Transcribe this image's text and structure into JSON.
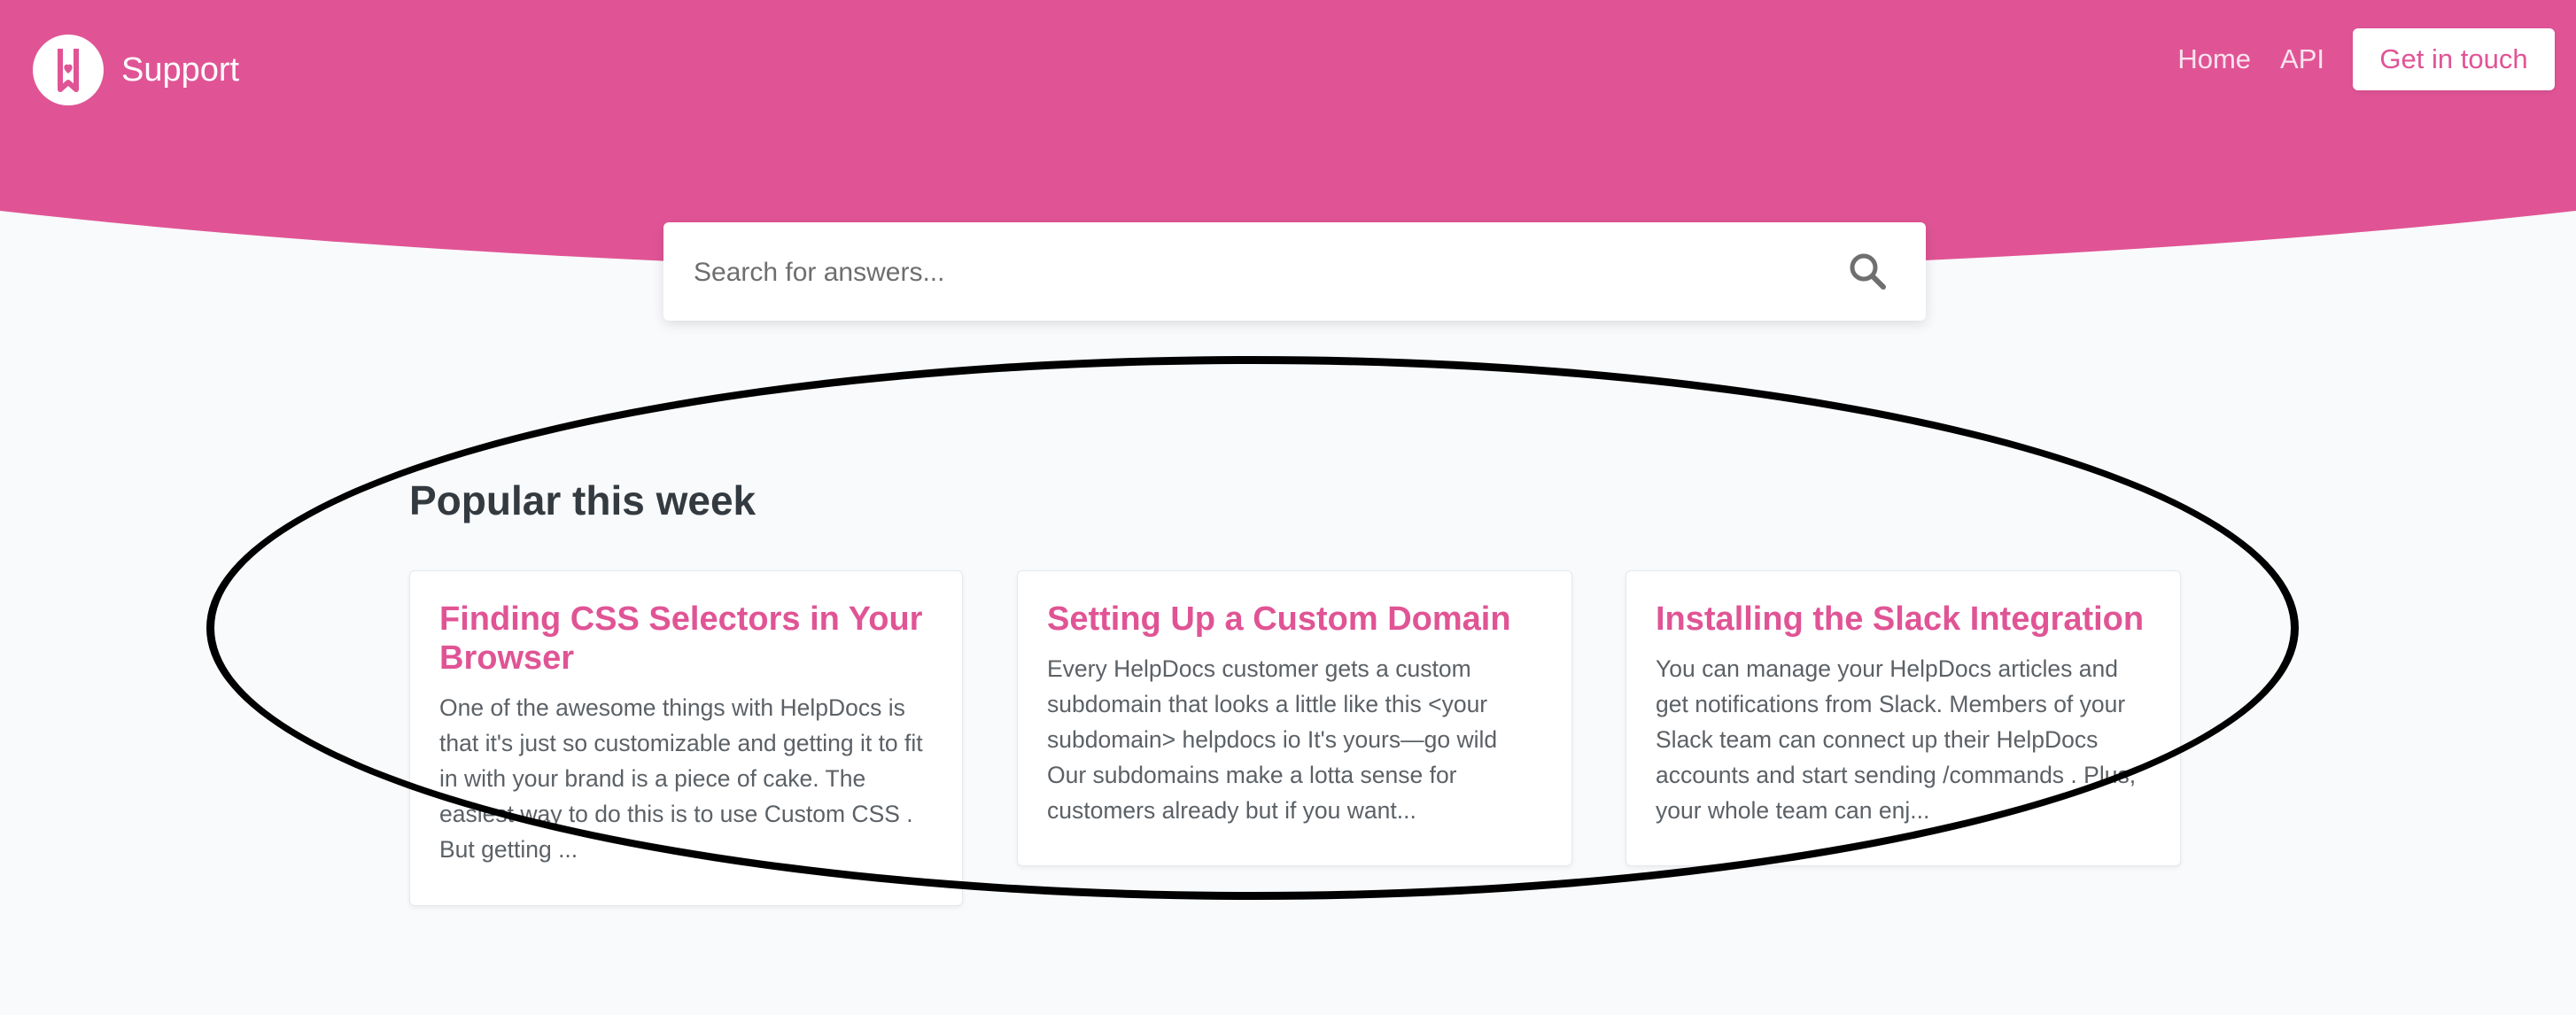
{
  "header": {
    "brand": "Support",
    "nav": {
      "home": "Home",
      "api": "API",
      "cta": "Get in touch"
    },
    "accent_color": "#e05495"
  },
  "search": {
    "placeholder": "Search for answers...",
    "icon": "search-icon"
  },
  "popular": {
    "title": "Popular this week",
    "cards": [
      {
        "title": "Finding CSS Selectors in Your Browser",
        "excerpt": "One of the awesome things with HelpDocs is that it's just so customizable and getting it to fit in with your brand is a piece of cake. The easiest way to do this is to use Custom CSS . But getting ..."
      },
      {
        "title": "Setting Up a Custom Domain",
        "excerpt": "Every HelpDocs customer gets a custom subdomain that looks a little like this <your subdomain> helpdocs io It's yours—go wild Our subdomains make a lotta sense for customers already but if you want..."
      },
      {
        "title": "Installing the Slack Integration",
        "excerpt": "You can manage your HelpDocs articles and get notifications from Slack. Members of your Slack team can connect up their HelpDocs accounts and start sending /commands . Plus, your whole team can enj..."
      }
    ]
  },
  "annotation": {
    "shape": "ellipse",
    "color": "#000000"
  }
}
